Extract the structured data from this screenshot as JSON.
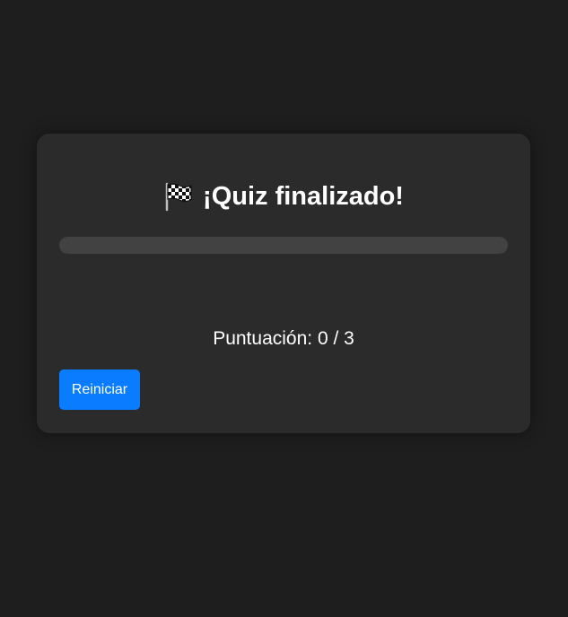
{
  "quiz": {
    "title": "¡Quiz finalizado!",
    "title_icon": "checkered-flag-icon",
    "progress_fraction": 0,
    "score_text": "Puntuación: 0 / 3",
    "restart_label": "Reiniciar"
  },
  "colors": {
    "background": "#1e1e1e",
    "card": "#2b2b2b",
    "progress_track": "#424242",
    "accent": "#0a7cff",
    "text": "#ffffff"
  }
}
